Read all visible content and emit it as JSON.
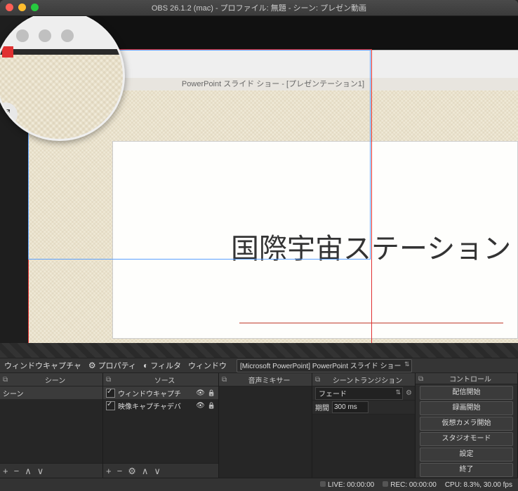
{
  "title": "OBS 26.1.2 (mac) - プロファイル: 無題 - シーン: プレゼン動画",
  "preview": {
    "ppt_titlebar": "PowerPoint スライド ショー - [プレゼンテーション1]",
    "slide_text": "国際宇宙ステーション",
    "selected_source_label": "ウィンドウキャプチャ"
  },
  "props": {
    "source_label": "ウィンドウキャプチャ",
    "properties": "プロパティ",
    "filters": "フィルタ",
    "window_label": "ウィンドウ",
    "window_value": "[Microsoft PowerPoint] PowerPoint スライド ショー"
  },
  "panels": {
    "scenes": {
      "title": "シーン",
      "items": [
        "シーン"
      ]
    },
    "sources": {
      "title": "ソース",
      "items": [
        "ウィンドウキャプチ",
        "映像キャプチャデバ"
      ]
    },
    "mixer": {
      "title": "音声ミキサー"
    },
    "transition": {
      "title": "シーントランジション",
      "type": "フェード",
      "duration_label": "期間",
      "duration_value": "300 ms"
    },
    "controls": {
      "title": "コントロール",
      "buttons": [
        "配信開始",
        "録画開始",
        "仮想カメラ開始",
        "スタジオモード",
        "設定",
        "終了"
      ]
    }
  },
  "status": {
    "live": "LIVE: 00:00:00",
    "rec": "REC: 00:00:00",
    "cpu": "CPU: 8.3%, 30.00 fps"
  }
}
